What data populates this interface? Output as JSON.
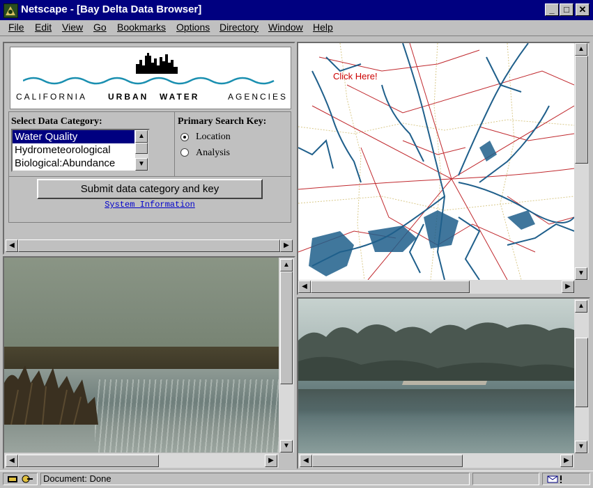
{
  "window": {
    "title": "Netscape - [Bay Delta Data Browser]",
    "minimize_label": "_",
    "maximize_label": "□",
    "close_label": "✕"
  },
  "menu": {
    "items": [
      "File",
      "Edit",
      "View",
      "Go",
      "Bookmarks",
      "Options",
      "Directory",
      "Window",
      "Help"
    ]
  },
  "banner": {
    "words": [
      "CALIFORNIA",
      "URBAN",
      "WATER",
      "AGENCIES"
    ]
  },
  "controls": {
    "category_heading": "Select Data Category:",
    "categories": [
      "Water Quality",
      "Hydrometeorological",
      "Biological:Abundance"
    ],
    "selected_category": "Water Quality",
    "search_key_heading": "Primary Search Key:",
    "search_keys": [
      "Location",
      "Analysis"
    ],
    "selected_search_key": "Location",
    "submit_label": "Submit data category and key",
    "system_info_link": "System Information"
  },
  "map": {
    "hint_text": "Click Here!",
    "hint_color": "#cc0000"
  },
  "status": {
    "text": "Document: Done"
  },
  "colors": {
    "titlebar": "#000080",
    "selection": "#000080",
    "link": "#0000cc",
    "map_water": "#1f5f8b",
    "map_roads": "#c0282d",
    "map_boundaries": "#d9c98a"
  }
}
